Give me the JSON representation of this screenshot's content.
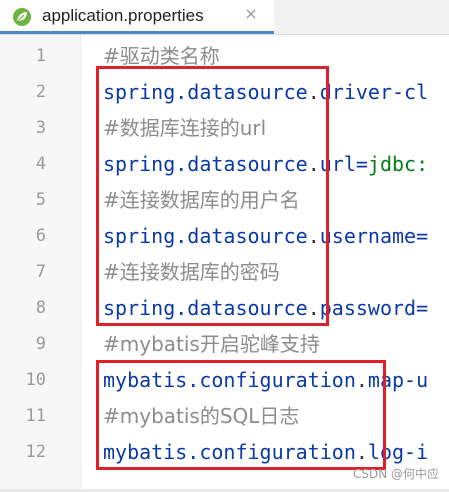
{
  "tab": {
    "title": "application.properties",
    "close_glyph": "×",
    "icon": "spring-leaf-icon",
    "accent": "#4a88c7"
  },
  "lines": [
    {
      "num": "1",
      "text": "#驱动类名称"
    },
    {
      "num": "2",
      "key": "spring.datasource",
      "sep": ".",
      "rest": "driver-cl"
    },
    {
      "num": "3",
      "text": "#数据库连接的url"
    },
    {
      "num": "4",
      "key": "spring.datasource",
      "sep": ".",
      "rest": "url=",
      "value": "jdbc:"
    },
    {
      "num": "5",
      "text": "#连接数据库的用户名"
    },
    {
      "num": "6",
      "key": "spring.datasource",
      "sep": ".",
      "rest": "username="
    },
    {
      "num": "7",
      "text": "#连接数据库的密码"
    },
    {
      "num": "8",
      "key": "spring.datasource",
      "sep": ".",
      "rest": "password="
    },
    {
      "num": "9",
      "text": "#mybatis开启驼峰支持"
    },
    {
      "num": "10",
      "key": "mybatis.configuration",
      "sep": ".",
      "rest": "map-u"
    },
    {
      "num": "11",
      "text": "#mybatis的SQL日志"
    },
    {
      "num": "12",
      "key": "mybatis.configuration",
      "sep": ".",
      "rest": "log-i"
    }
  ],
  "watermark": "CSDN @何中应",
  "colors": {
    "comment": "#8c8c8c",
    "key": "#0b3aa8",
    "value": "#067d17",
    "highlight_box": "#e0202a"
  }
}
